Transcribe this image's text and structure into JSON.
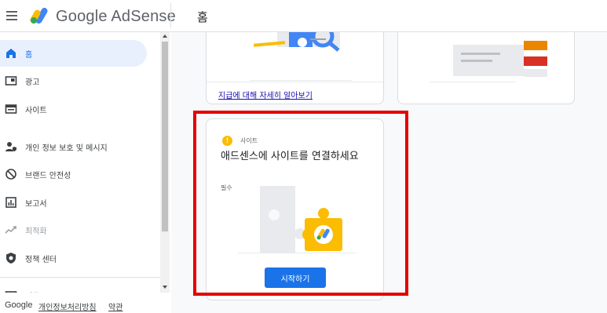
{
  "header": {
    "product_name": "Google AdSense",
    "page_title": "홈"
  },
  "sidebar": {
    "items": [
      {
        "label": "홈",
        "icon": "home-icon",
        "active": true
      },
      {
        "label": "광고",
        "icon": "ads-icon"
      },
      {
        "label": "사이트",
        "icon": "sites-icon"
      },
      {
        "label": "개인 정보 보호 및 메시지",
        "icon": "privacy-messaging-icon"
      },
      {
        "label": "브랜드 안전성",
        "icon": "brand-safety-icon"
      },
      {
        "label": "보고서",
        "icon": "reports-icon"
      },
      {
        "label": "최적화",
        "icon": "optimization-icon",
        "disabled": true
      },
      {
        "label": "정책 센터",
        "icon": "policy-center-icon"
      },
      {
        "label": "지급",
        "icon": "payments-icon"
      }
    ]
  },
  "footer": {
    "brand": "Google",
    "privacy_link": "개인정보처리방침",
    "terms_link": "약관"
  },
  "cards": {
    "learn_more_link": "지급에 대해 자세히 알아보기",
    "site_card": {
      "category": "사이트",
      "title": "애드센스에 사이트를 연결하세요",
      "required": "필수",
      "button": "시작하기"
    }
  },
  "colors": {
    "accent": "#1a73e8",
    "warning": "#fbbc04",
    "highlight": "#e60000",
    "nav_active_bg": "#e8f0fe"
  }
}
